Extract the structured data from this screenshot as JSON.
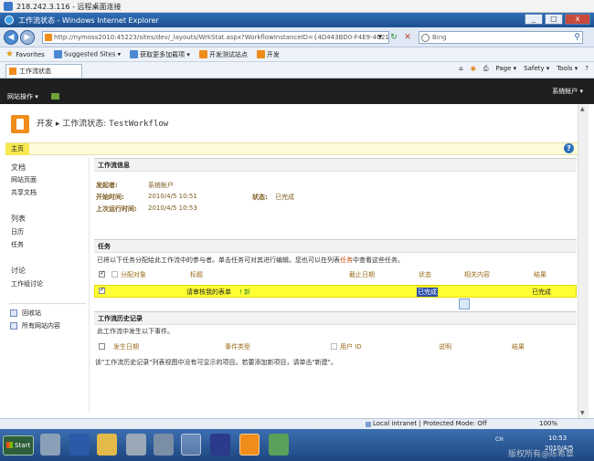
{
  "rdp": {
    "title": "218.242.3.116 - 远程桌面连接"
  },
  "ie": {
    "title": "工作流状态 - Windows Internet Explorer",
    "address": "http://nymoss2010:45223/sites/dev/_layouts/WrkStat.aspx?WorkflowInstanceID={4D443BD0-F4E9-4C21-B892-4",
    "search_placeholder": "Bing",
    "window_buttons": [
      "_",
      "□",
      "x"
    ],
    "favorites": {
      "label": "Favorites",
      "items": [
        "Suggested Sites ▾",
        "获取更多加载项 ▾",
        "开发测试站点",
        "开发"
      ]
    },
    "tab_title": "工作流状态",
    "commands": [
      "Page ▾",
      "Safety ▾",
      "Tools ▾",
      "?"
    ]
  },
  "sp": {
    "site_actions": "网站操作 ▾",
    "user": "系统帐户 ▾",
    "breadcrumb_site": "开发",
    "breadcrumb_sep": "▸",
    "breadcrumb_page": "工作流状态: ",
    "breadcrumb_wf": "TestWorkflow",
    "home_tab": "主页",
    "help": "?",
    "left_nav": {
      "docs_header": "文档",
      "site_pages": "网站页面",
      "shared_docs": "共享文档",
      "lists_header": "列表",
      "calendar": "日历",
      "tasks": "任务",
      "discussions_header": "讨论",
      "team_discussion": "工作组讨论",
      "recycle_bin": "回收站",
      "all_content": "所有网站内容"
    },
    "info": {
      "header": "工作流信息",
      "initiator_label": "发起者:",
      "initiator": "系统帐户",
      "started_label": "开始时间:",
      "started": "2010/4/5 10:51",
      "status_label": "状态:",
      "status": "已完成",
      "last_run_label": "上次运行时间:",
      "last_run": "2010/4/5 10:53"
    },
    "tasks": {
      "header": "任务",
      "note_pre": "已将以下任务分配给此工作流中的参与者。单击任务可对其进行编辑。您也可以在列表",
      "note_link": "任务",
      "note_post": "中查看这些任务。",
      "columns": [
        "分配对象",
        "标题",
        "截止日期",
        "状态",
        "相关内容",
        "结果"
      ],
      "rows": [
        {
          "title": "请审核我的表单",
          "badge": "! 新",
          "status": "已完成",
          "outcome": "已完成"
        }
      ]
    },
    "history": {
      "header": "工作流历史记录",
      "note": "此工作流中发生以下事件。",
      "columns": [
        "发生日期",
        "事件类型",
        "用户 ID",
        "说明",
        "结果"
      ],
      "empty": "该\"工作流历史记录\"列表视图中没有可显示的项目。若要添加新项目，请单击\"新建\"。"
    }
  },
  "status_bar": {
    "zone": "Local intranet | Protected Mode: Off",
    "zoom": "100%"
  },
  "taskbar": {
    "start": "Start",
    "time": "10:53",
    "date": "2010/4/5",
    "lang": "CH",
    "watermark": "版权所有@陈希章"
  }
}
